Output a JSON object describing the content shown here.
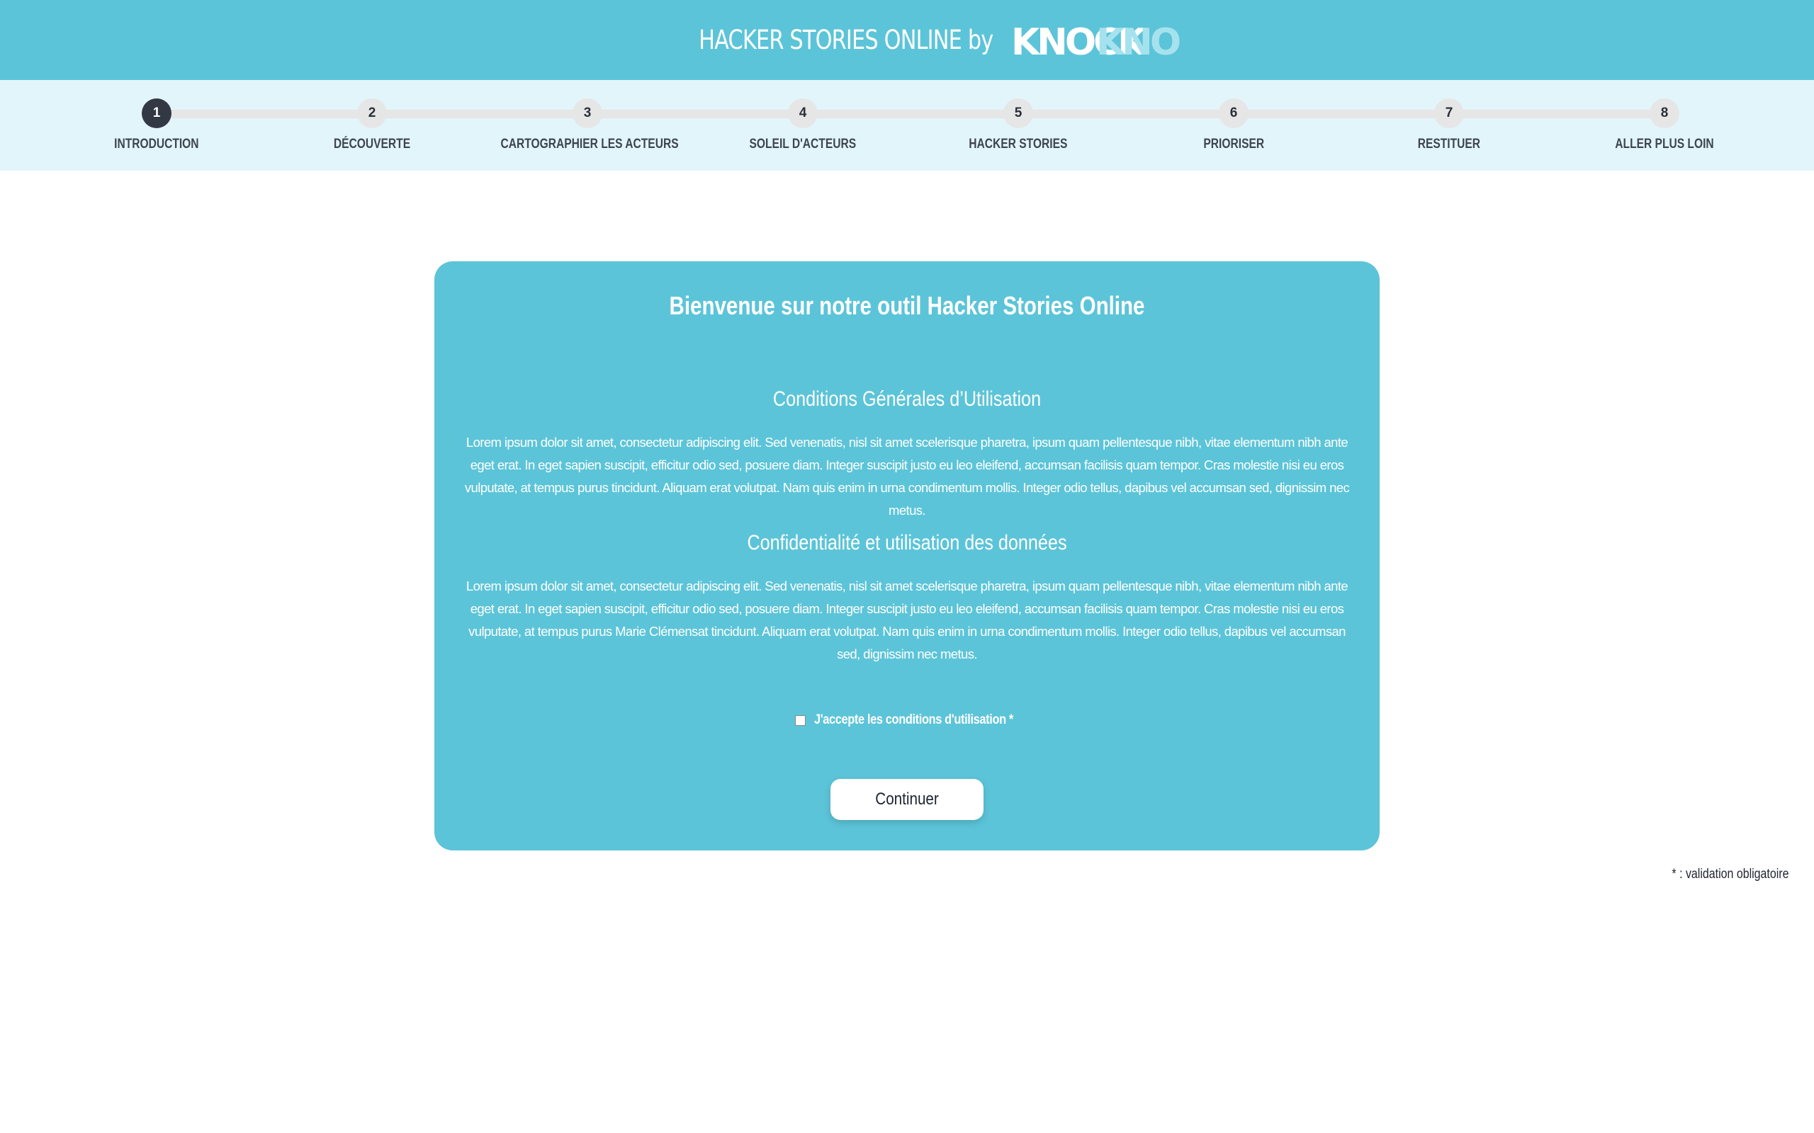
{
  "header": {
    "title": "HACKER STORIES ONLINE by",
    "logo": {
      "part1": "KNOCK",
      "part2": "KNOCK",
      "color1": "#ffffff",
      "color2": "#a6e2ee"
    }
  },
  "stepper": {
    "current": 1,
    "steps": [
      {
        "number": "1",
        "label": "INTRODUCTION"
      },
      {
        "number": "2",
        "label": "DÉCOUVERTE"
      },
      {
        "number": "3",
        "label": "CARTOGRAPHIER LES ACTEURS"
      },
      {
        "number": "4",
        "label": "SOLEIL D'ACTEURS"
      },
      {
        "number": "5",
        "label": "HACKER STORIES"
      },
      {
        "number": "6",
        "label": "PRIORISER"
      },
      {
        "number": "7",
        "label": "RESTITUER"
      },
      {
        "number": "8",
        "label": "ALLER PLUS LOIN"
      }
    ]
  },
  "card": {
    "title": "Bienvenue sur notre outil Hacker Stories Online",
    "sections": [
      {
        "heading": "Conditions Générales d’Utilisation",
        "text": "Lorem ipsum dolor sit amet, consectetur adipiscing elit. Sed venenatis, nisl sit amet scelerisque pharetra, ipsum quam pellentesque nibh, vitae elementum nibh ante eget erat. In eget sapien suscipit, efficitur odio sed, posuere diam. Integer suscipit justo eu leo eleifend, accumsan facilisis quam tempor. Cras molestie nisi eu eros vulputate, at tempus purus tincidunt. Aliquam erat volutpat. Nam quis enim in urna condimentum mollis. Integer odio tellus, dapibus vel accumsan sed, dignissim nec metus."
      },
      {
        "heading": "Confidentialité et utilisation des données",
        "text": "Lorem ipsum dolor sit amet, consectetur adipiscing elit. Sed venenatis, nisl sit amet scelerisque pharetra, ipsum quam pellentesque nibh, vitae elementum nibh ante eget erat. In eget sapien suscipit, efficitur odio sed, posuere diam. Integer suscipit justo eu leo eleifend, accumsan facilisis quam tempor. Cras molestie nisi eu eros vulputate, at tempus purus Marie Clémensat tincidunt. Aliquam erat volutpat. Nam quis enim in urna condimentum mollis. Integer odio tellus, dapibus vel accumsan sed, dignissim nec metus."
      }
    ],
    "accept_label": "J'accepte les conditions d'utilisation *",
    "accept_checked": false,
    "continue_label": "Continuer"
  },
  "footnote": "* : validation obligatoire",
  "colors": {
    "primary": "#5cc4d8",
    "stepper_bg": "#e2f5fa",
    "active_step": "#333845",
    "inactive_step": "#e6e6e6"
  }
}
